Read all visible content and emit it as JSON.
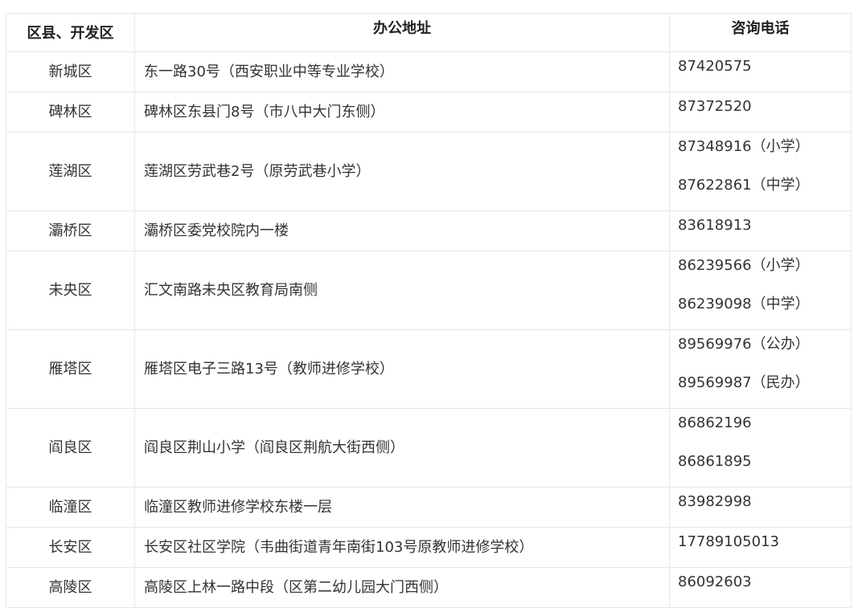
{
  "table": {
    "headers": {
      "district": "区县、开发区",
      "address": "办公地址",
      "phone": "咨询电话"
    },
    "rows": [
      {
        "district": "新城区",
        "address": "东一路30号（西安职业中等专业学校）",
        "phones": [
          "87420575"
        ]
      },
      {
        "district": "碑林区",
        "address": "碑林区东县门8号（市八中大门东侧）",
        "phones": [
          "87372520"
        ]
      },
      {
        "district": "莲湖区",
        "address": "莲湖区劳武巷2号（原劳武巷小学）",
        "phones": [
          "87348916（小学）",
          "87622861（中学）"
        ]
      },
      {
        "district": "灞桥区",
        "address": "灞桥区委党校院内一楼",
        "phones": [
          "83618913"
        ]
      },
      {
        "district": "未央区",
        "address": "汇文南路未央区教育局南侧",
        "phones": [
          "86239566（小学）",
          "86239098（中学）"
        ]
      },
      {
        "district": "雁塔区",
        "address": "雁塔区电子三路13号（教师进修学校）",
        "phones": [
          "89569976（公办）",
          "89569987（民办）"
        ]
      },
      {
        "district": "阎良区",
        "address": "阎良区荆山小学（阎良区荆航大街西侧）",
        "phones": [
          "86862196",
          "86861895"
        ]
      },
      {
        "district": "临潼区",
        "address": "临潼区教师进修学校东楼一层",
        "phones": [
          "83982998"
        ]
      },
      {
        "district": "长安区",
        "address": "长安区社区学院（韦曲街道青年南街103号原教师进修学校）",
        "phones": [
          "17789105013"
        ]
      },
      {
        "district": "高陵区",
        "address": "高陵区上林一路中段（区第二幼儿园大门西侧）",
        "phones": [
          "86092603"
        ]
      }
    ]
  }
}
